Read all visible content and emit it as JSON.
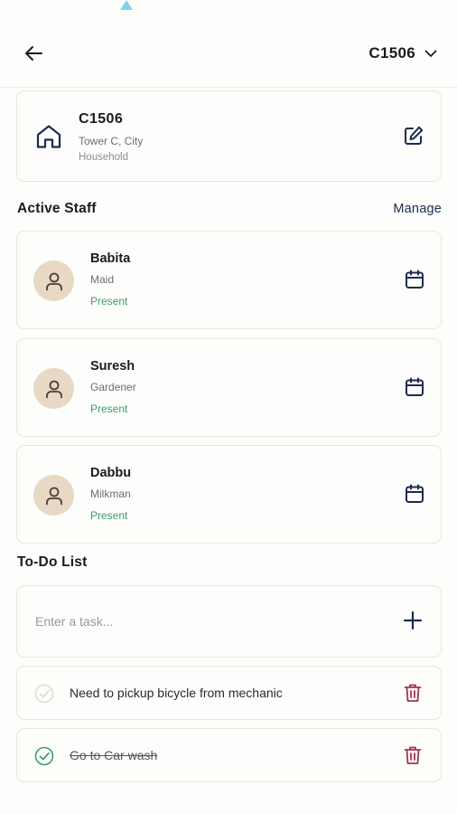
{
  "header": {
    "unit_label": "C1506"
  },
  "property": {
    "title": "C1506",
    "address": "Tower C, City",
    "type": "Household"
  },
  "active_staff": {
    "title": "Active Staff",
    "manage_label": "Manage",
    "items": [
      {
        "name": "Babita",
        "role": "Maid",
        "status": "Present"
      },
      {
        "name": "Suresh",
        "role": "Gardener",
        "status": "Present"
      },
      {
        "name": "Dabbu",
        "role": "Milkman",
        "status": "Present"
      }
    ]
  },
  "todo": {
    "title": "To-Do List",
    "input_placeholder": "Enter a task...",
    "items": [
      {
        "text": "Need to pickup bicycle from mechanic",
        "done": false
      },
      {
        "text": "Go to Car wash",
        "done": true
      }
    ]
  },
  "colors": {
    "navy": "#1d2b4f",
    "present_green": "#3f9a6b",
    "delete_red": "#a3354a",
    "card_border": "#ece6d6",
    "avatar_bg": "#e8d9c4"
  },
  "icons": {
    "back": "arrow-left-icon",
    "dropdown": "chevron-down-icon",
    "home": "home-icon",
    "edit": "edit-icon",
    "avatar": "user-icon",
    "calendar": "calendar-icon",
    "add": "plus-icon",
    "check": "check-circle-icon",
    "delete": "trash-icon"
  }
}
